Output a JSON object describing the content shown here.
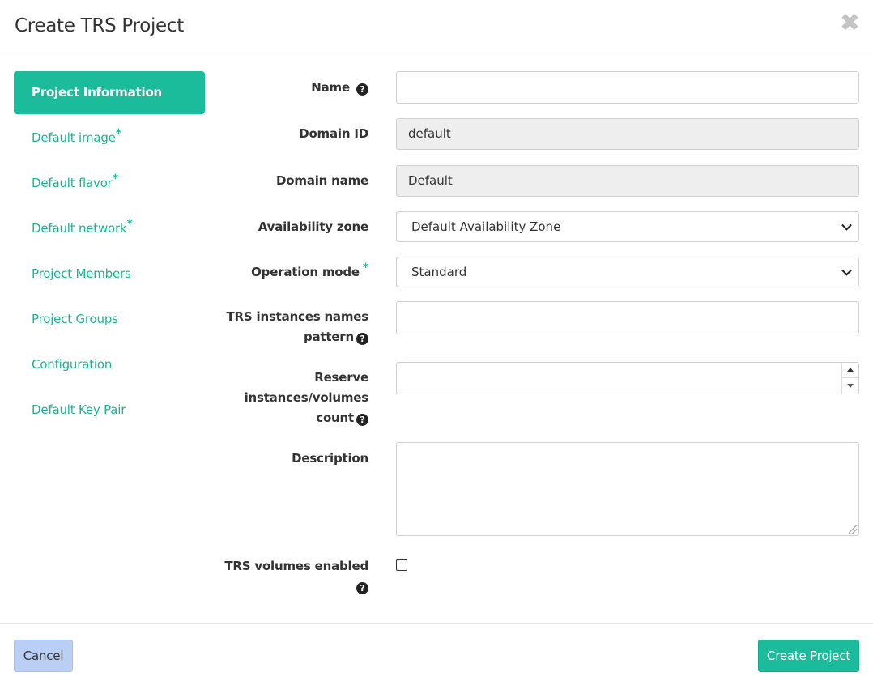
{
  "dialog": {
    "title": "Create TRS Project",
    "close_symbol": "✖"
  },
  "sidebar": {
    "items": [
      {
        "label": "Project Information",
        "required": false,
        "active": true
      },
      {
        "label": "Default image",
        "required": true,
        "active": false
      },
      {
        "label": "Default flavor",
        "required": true,
        "active": false
      },
      {
        "label": "Default network",
        "required": true,
        "active": false
      },
      {
        "label": "Project Members",
        "required": false,
        "active": false
      },
      {
        "label": "Project Groups",
        "required": false,
        "active": false
      },
      {
        "label": "Configuration",
        "required": false,
        "active": false
      },
      {
        "label": "Default Key Pair",
        "required": false,
        "active": false
      }
    ],
    "required_marker": "*"
  },
  "form": {
    "name": {
      "label": "Name",
      "value": ""
    },
    "domain_id": {
      "label": "Domain ID",
      "value": "default"
    },
    "domain_name": {
      "label": "Domain name",
      "value": "Default"
    },
    "availability_zone": {
      "label": "Availability zone",
      "value": "Default Availability Zone"
    },
    "operation_mode": {
      "label": "Operation mode",
      "value": "Standard",
      "required_marker": "*"
    },
    "names_pattern": {
      "label_line1": "TRS instances names",
      "label_line2": "pattern",
      "value": ""
    },
    "reserve_count": {
      "label_line1": "Reserve",
      "label_line2": "instances/volumes",
      "label_line3": "count",
      "value": ""
    },
    "description": {
      "label": "Description",
      "value": ""
    },
    "volumes_enabled": {
      "label": "TRS volumes enabled",
      "checked": false
    }
  },
  "footer": {
    "cancel_label": "Cancel",
    "create_label": "Create Project"
  },
  "icons": {
    "help": "?"
  },
  "colors": {
    "accent": "#1abc9c",
    "cancel_bg": "#b9cff5"
  }
}
